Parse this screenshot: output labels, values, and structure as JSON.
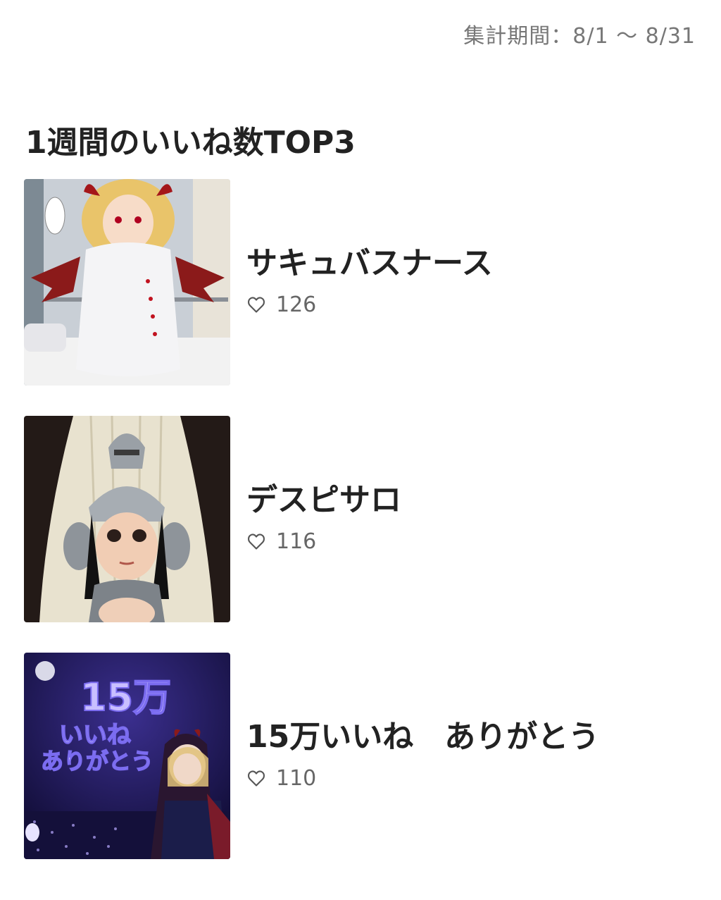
{
  "period": {
    "label": "集計期間：8/1 〜 8/31"
  },
  "section": {
    "title": "1週間のいいね数TOP3"
  },
  "ranking": [
    {
      "title": "サキュバスナース",
      "likes": "126",
      "icon": "heart-icon",
      "thumbnail": "succubus-nurse-illustration"
    },
    {
      "title": "デスピサロ",
      "likes": "116",
      "icon": "heart-icon",
      "thumbnail": "armored-knight-illustration"
    },
    {
      "title": "15万いいね　ありがとう",
      "likes": "110",
      "icon": "heart-icon",
      "thumbnail": "night-sky-thanks-illustration"
    }
  ],
  "thumbnail_texts": {
    "thanks_line1": "15万",
    "thanks_line2": "いいね",
    "thanks_line3": "ありがとう"
  },
  "colors": {
    "text": "#222222",
    "muted": "#777777",
    "like_count": "#666666"
  }
}
